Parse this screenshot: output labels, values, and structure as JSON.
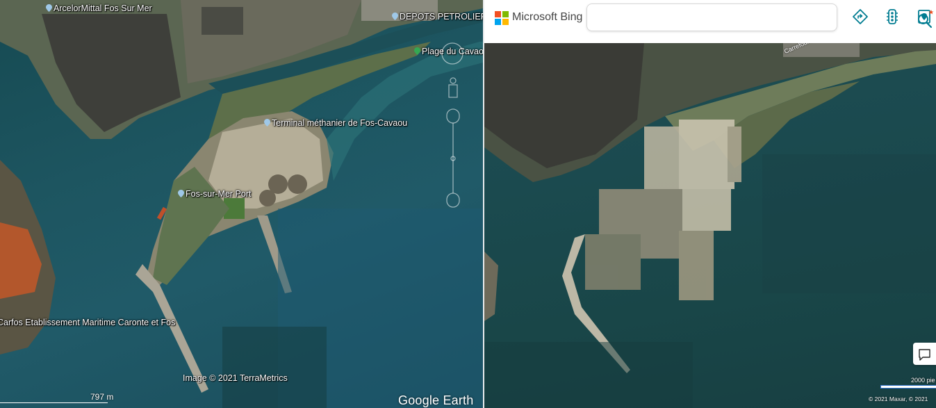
{
  "google_earth": {
    "places": {
      "arcelormittal": "ArcelorMittal Fos Sur Mer",
      "depots_petroliers": "DEPOTS PETROLIER",
      "plage_cavaou": "Plage du Cavao",
      "terminal_methanier": "Terminal méthanier de Fos-Cavaou",
      "fos_port": "Fos-sur-Mer Port",
      "carfos": "Carfos Etablissement Maritime Caronte et Fos"
    },
    "attribution": "Image © 2021 TerraMetrics",
    "scale_label": "797  m",
    "logo": "Google Earth",
    "icon_colors": {
      "place_pin": "#9fc8e8",
      "park_pin": "#34a853"
    }
  },
  "bing": {
    "brand": "Microsoft Bing",
    "search": {
      "value": "",
      "placeholder": ""
    },
    "road_label": "Carrefour des Jones",
    "scale_label": "2000 pie",
    "attribution": "© 2021 Maxar, © 2021",
    "icons": [
      "directions-icon",
      "traffic-icon",
      "my-places-icon",
      "search-icon",
      "feedback-icon"
    ],
    "accent": "#007c91",
    "logo_colors": [
      "#f25022",
      "#7fba00",
      "#00a4ef",
      "#ffb900"
    ]
  }
}
